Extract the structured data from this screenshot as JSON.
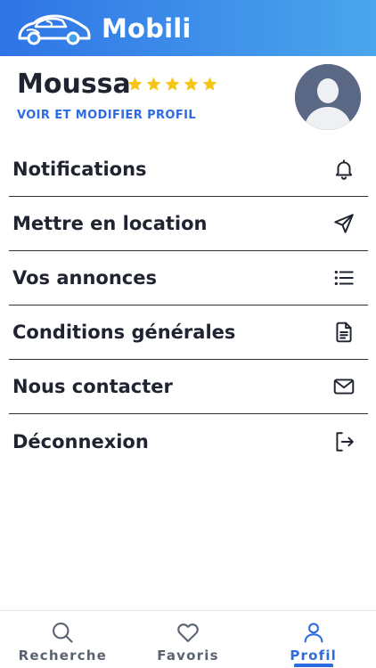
{
  "app": {
    "title": "Mobili"
  },
  "profile": {
    "name": "Moussa",
    "rating": 5,
    "rating_max": 5,
    "link_label": "VOIR ET MODIFIER PROFIL"
  },
  "menu": {
    "items": [
      {
        "label": "Notifications",
        "icon": "bell-icon"
      },
      {
        "label": "Mettre en location",
        "icon": "send-icon"
      },
      {
        "label": "Vos annonces",
        "icon": "list-icon"
      },
      {
        "label": "Conditions générales",
        "icon": "document-icon"
      },
      {
        "label": "Nous contacter",
        "icon": "mail-icon"
      },
      {
        "label": "Déconnexion",
        "icon": "logout-icon"
      }
    ]
  },
  "bottom_nav": {
    "tabs": [
      {
        "label": "Recherche",
        "icon": "search-icon",
        "active": false
      },
      {
        "label": "Favoris",
        "icon": "heart-icon",
        "active": false
      },
      {
        "label": "Profil",
        "icon": "user-icon",
        "active": true
      }
    ]
  },
  "colors": {
    "header_start": "#2f74e6",
    "header_end": "#4aa6ec",
    "accent": "#2d6cdf",
    "star": "#f5c518",
    "avatar_bg": "#5a6886"
  }
}
